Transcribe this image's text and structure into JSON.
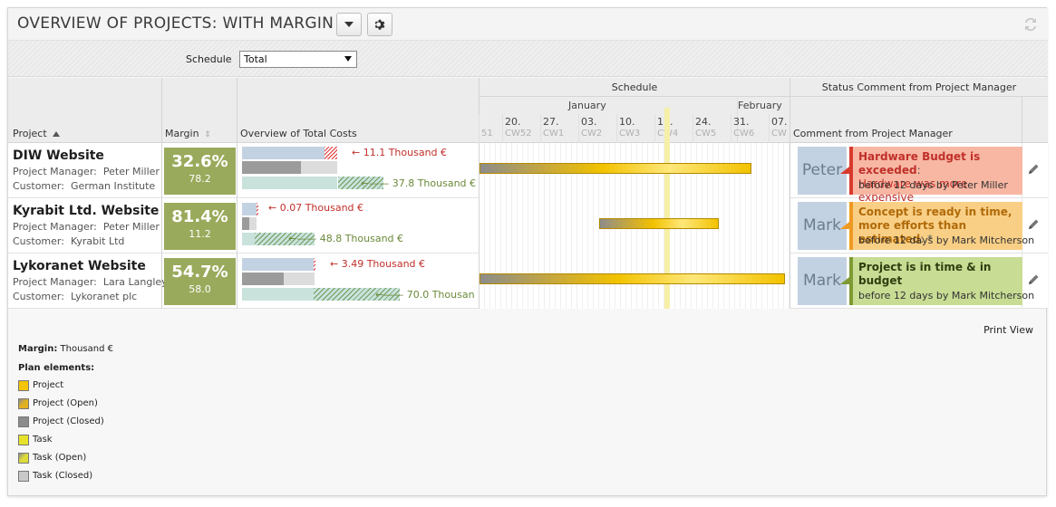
{
  "header": {
    "title": "OVERVIEW OF PROJECTS: WITH MARGIN"
  },
  "filter": {
    "label": "Schedule",
    "value": "Total"
  },
  "columns": {
    "project": "Project",
    "margin": "Margin",
    "costs": "Overview of Total Costs",
    "schedule": "Schedule",
    "status": "Status Comment from Project Manager",
    "comment": "Comment from Project Manager"
  },
  "timeline": {
    "months": [
      "January",
      "February"
    ],
    "dates": [
      "20.",
      "27.",
      "03.",
      "10.",
      "17.",
      "24.",
      "31.",
      "07."
    ],
    "weeks": [
      "51",
      "CW52",
      "CW1",
      "CW2",
      "CW3",
      "CW4",
      "CW5",
      "CW6",
      "CW"
    ]
  },
  "rows": [
    {
      "name": "DIW Website",
      "manager_label": "Project Manager:",
      "manager": "Peter Miller",
      "customer_label": "Customer:",
      "customer": "German Institute",
      "margin_pct": "32.6%",
      "margin_val": "78.2",
      "cost_over": "11.1 Thousand €",
      "cost_total": "37.8 Thousand €",
      "avatar": "Peter",
      "comment_title": "Hardware Budget is exceeded",
      "comment_title_suffix": ":",
      "comment_body": "Hardware was more expensive",
      "comment_meta": "before 12 days  by Peter Miller",
      "status_color": "#f7b7a3",
      "status_border": "#d83a2e"
    },
    {
      "name": "Kyrabit Ltd. Website",
      "manager_label": "Project Manager:",
      "manager": "Peter Miller",
      "customer_label": "Customer:",
      "customer": "Kyrabit Ltd",
      "margin_pct": "81.4%",
      "margin_val": "11.2",
      "cost_over": "0.07 Thousand €",
      "cost_total": "48.8 Thousand €",
      "avatar": "Mark",
      "comment_title": "Concept is ready in time, more efforts than estimated",
      "comment_title_suffix": ": *",
      "comment_body": "",
      "comment_meta": "before 12 days  by Mark Mitcherson",
      "status_color": "#f9cf86",
      "status_border": "#ee9a22"
    },
    {
      "name": "Lykoranet Website",
      "manager_label": "Project Manager:",
      "manager": "Lara Langley",
      "customer_label": "Customer:",
      "customer": "Lykoranet plc",
      "margin_pct": "54.7%",
      "margin_val": "58.0",
      "cost_over": "3.49 Thousand €",
      "cost_total": "70.0 Thousan",
      "avatar": "Mark",
      "comment_title": "Project is in time & in budget",
      "comment_title_suffix": "",
      "comment_body": "",
      "comment_meta": "before 12 days  by Mark Mitcherson",
      "status_color": "#c8dc94",
      "status_border": "#7d9a34"
    }
  ],
  "footer": {
    "print": "Print View",
    "margin_label": "Margin:",
    "margin_unit": "Thousand €",
    "plan_label": "Plan elements:",
    "legend": [
      {
        "label": "Project",
        "color": "#f5c400"
      },
      {
        "label": "Project (Open)",
        "color": "#e0b020"
      },
      {
        "label": "Project (Closed)",
        "color": "#8c8c8c"
      },
      {
        "label": "Task",
        "color": "#e6e22a"
      },
      {
        "label": "Task (Open)",
        "color": "#dedc3a"
      },
      {
        "label": "Task (Closed)",
        "color": "#c9c9c9"
      }
    ]
  },
  "colors": {
    "margin_green": "#9aaa5c",
    "over_red": "#c0302a",
    "under_green": "#6b8a3a",
    "plan_blue": "#c3d2e2"
  }
}
